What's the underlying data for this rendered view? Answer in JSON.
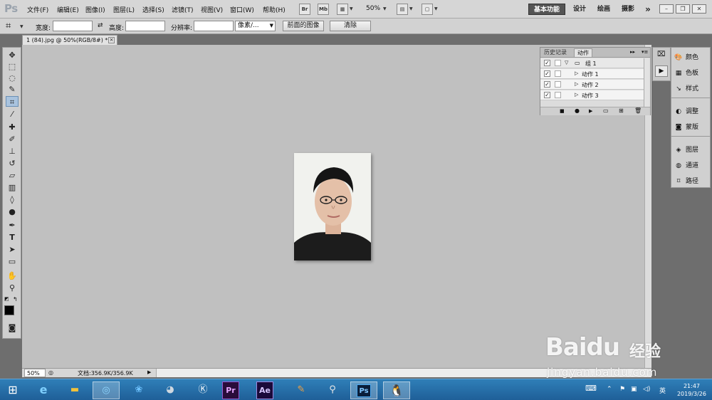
{
  "app": {
    "logo": "Ps",
    "menu": [
      "文件(F)",
      "编辑(E)",
      "图像(I)",
      "图层(L)",
      "选择(S)",
      "滤镜(T)",
      "视图(V)",
      "窗口(W)",
      "帮助(H)"
    ],
    "bridge_btn": "Br",
    "minibridge_btn": "Mb",
    "zoom": "50%",
    "workspaces": [
      "基本功能",
      "设计",
      "绘画",
      "摄影"
    ],
    "more_workspaces": "»"
  },
  "options": {
    "width_label": "宽度:",
    "width_value": "",
    "height_label": "高度:",
    "height_value": "",
    "resolution_label": "分辨率:",
    "resolution_value": "",
    "unit": "像素/...",
    "front_image_btn": "前面的图像",
    "clear_btn": "清除"
  },
  "document": {
    "tab_title": "1 (84).jpg @ 50%(RGB/8#) *",
    "status_zoom": "50%",
    "status_info": "文档:356.9K/356.9K"
  },
  "actions_panel": {
    "tab_history": "历史记录",
    "tab_actions": "动作",
    "rows": [
      {
        "label": "组 1",
        "checked": true
      },
      {
        "label": "动作 1",
        "checked": true
      },
      {
        "label": "动作 2",
        "checked": true
      },
      {
        "label": "动作 3",
        "checked": true
      }
    ]
  },
  "dock": {
    "items": [
      {
        "label": "颜色",
        "icon": "palette-icon"
      },
      {
        "label": "色板",
        "icon": "swatches-icon"
      },
      {
        "label": "样式",
        "icon": "styles-icon"
      },
      {
        "label": "调整",
        "icon": "adjustments-icon"
      },
      {
        "label": "蒙版",
        "icon": "masks-icon"
      },
      {
        "label": "图层",
        "icon": "layers-icon"
      },
      {
        "label": "通道",
        "icon": "channels-icon"
      },
      {
        "label": "路径",
        "icon": "paths-icon"
      }
    ]
  },
  "taskbar": {
    "time": "21:47",
    "date": "2019/3/26",
    "ime": "英",
    "apps": [
      "Pr",
      "Ae",
      "Ps"
    ]
  },
  "watermark": {
    "brand": "Baidu",
    "cn": "经验",
    "url": "jingyan.baidu.com"
  }
}
